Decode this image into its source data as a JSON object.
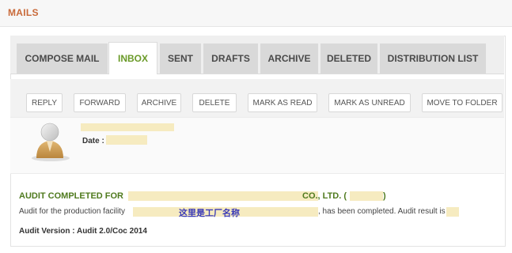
{
  "header": {
    "title": "MAILS"
  },
  "tabs": [
    {
      "label": "COMPOSE MAIL",
      "active": false
    },
    {
      "label": "INBOX",
      "active": true
    },
    {
      "label": "SENT",
      "active": false
    },
    {
      "label": "DRAFTS",
      "active": false
    },
    {
      "label": "ARCHIVE",
      "active": false
    },
    {
      "label": "DELETED",
      "active": false
    },
    {
      "label": "DISTRIBUTION LIST",
      "active": false
    }
  ],
  "toolbar": {
    "buttons": [
      "REPLY",
      "FORWARD",
      "ARCHIVE",
      "DELETE",
      "MARK AS READ",
      "MARK AS UNREAD",
      "MOVE TO FOLDER"
    ]
  },
  "message": {
    "date_label": "Date :",
    "subject_prefix": "AUDIT COMPLETED FOR",
    "subject_suffix": "CO., LTD. (",
    "subject_close": ")",
    "body_prefix": "Audit for the production facility",
    "factory_note": "这里是工厂名称",
    "body_suffix": ", has been completed. Audit result is",
    "audit_version": "Audit Version : Audit 2.0/Coc 2014"
  },
  "colors": {
    "accent_orange": "#c96a3a",
    "accent_green": "#6a9a28",
    "subject_green": "#4f7a1e",
    "highlight": "#f6ebc0"
  },
  "icons": {
    "avatar": "user-avatar-icon"
  }
}
